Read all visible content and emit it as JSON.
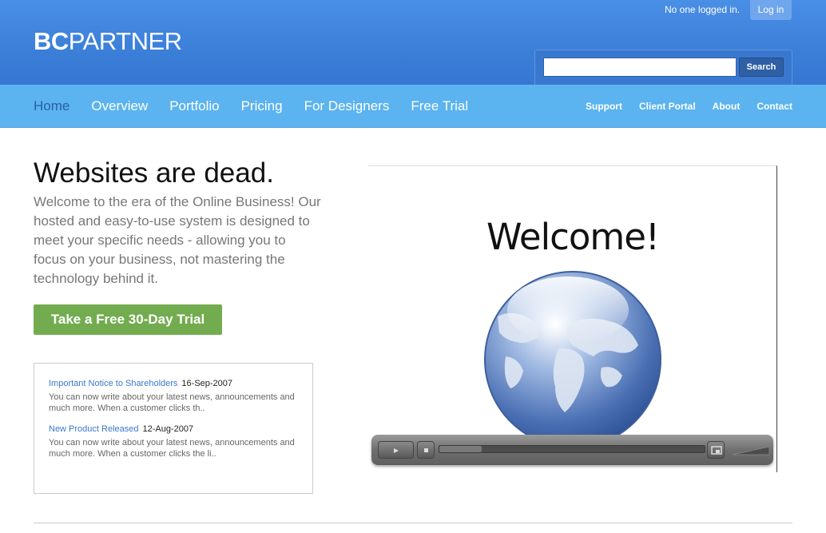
{
  "header": {
    "logo_bold": "BC",
    "logo_light": "PARTNER",
    "login_status": "No one logged in.",
    "login_label": "Log in",
    "search_placeholder": "",
    "search_label": "Search"
  },
  "nav": {
    "main": [
      {
        "label": "Home",
        "active": true
      },
      {
        "label": "Overview"
      },
      {
        "label": "Portfolio"
      },
      {
        "label": "Pricing"
      },
      {
        "label": "For Designers"
      },
      {
        "label": "Free Trial"
      }
    ],
    "secondary": [
      "Support",
      "Client Portal",
      "About",
      "Contact"
    ]
  },
  "hero": {
    "headline": "Websites are dead.",
    "intro": "Welcome to the era of the Online Business! Our hosted and easy-to-use system is designed to meet your specific needs - allowing you to focus on your business, not mastering the technology behind it.",
    "cta_label": "Take a Free 30-Day Trial"
  },
  "news": [
    {
      "title": "Important Notice to Shareholders",
      "date": "16-Sep-2007",
      "text": "You can now write about your latest news, announcements and much more. When a customer clicks th.."
    },
    {
      "title": "New Product Released",
      "date": "12-Aug-2007",
      "text": "You can now write about your latest news, announcements and much more. When a customer clicks the li.."
    }
  ],
  "video": {
    "title_text": "Welcome!",
    "progress": 0.16
  },
  "colors": {
    "header_blue": "#3b7fd9",
    "nav_blue": "#5bb3ef",
    "cta_green": "#72ac4f",
    "link_blue": "#3a78cf"
  }
}
